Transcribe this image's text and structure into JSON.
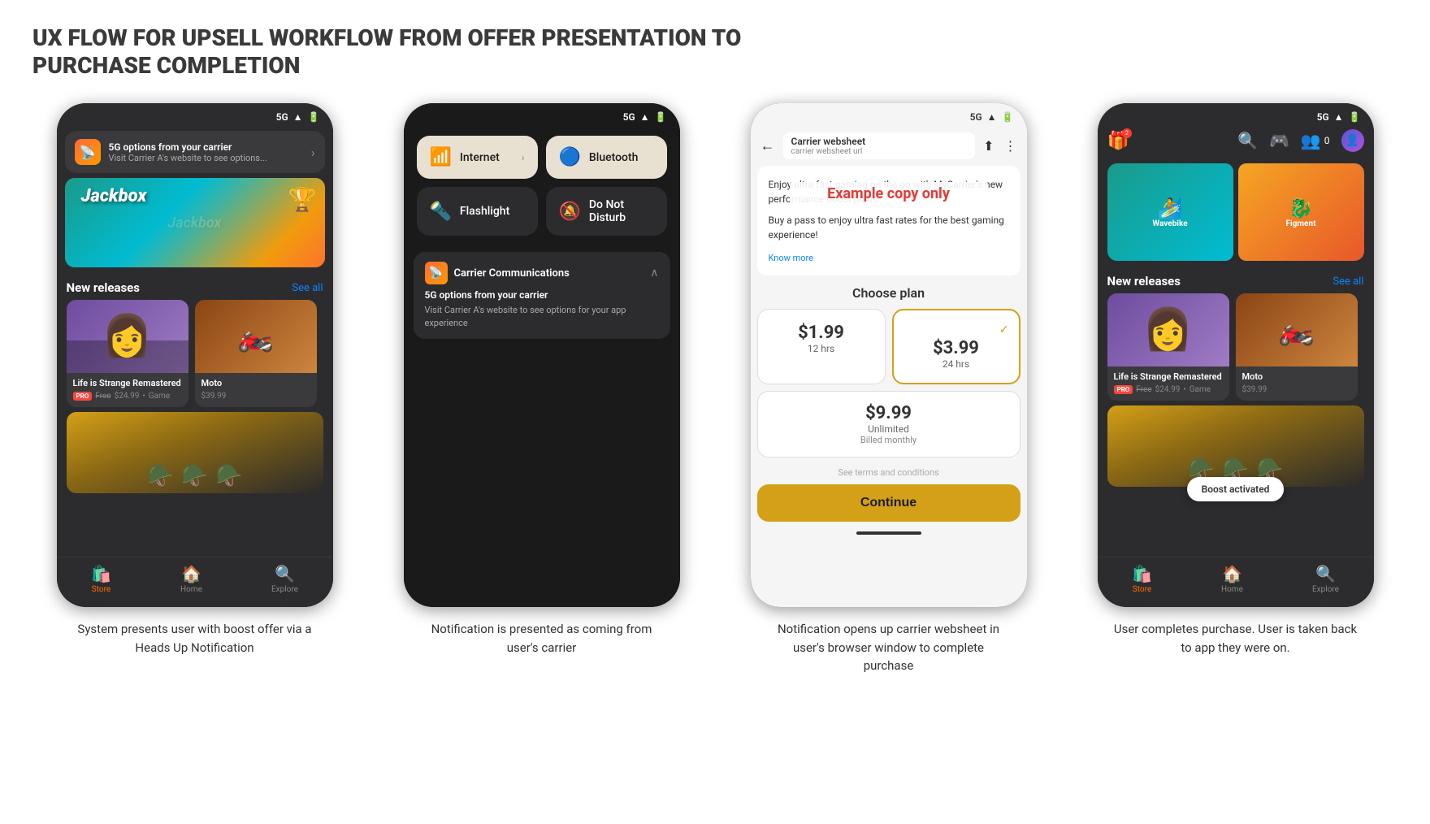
{
  "page": {
    "title": "UX FLOW FOR UPSELL WORKFLOW FROM OFFER PRESENTATION TO PURCHASE COMPLETION"
  },
  "phone1": {
    "status": "5G",
    "notification": {
      "title": "5G options from your carrier",
      "subtitle": "Visit Carrier A's website to see options..."
    },
    "game_banner": "Jackbox",
    "new_releases": "New releases",
    "see_all": "See all",
    "cards": [
      {
        "title": "Life is Strange Remastered",
        "pro": "PRO",
        "price_free": "Free",
        "price_orig": "$24.99",
        "genre": "Game"
      },
      {
        "title": "Moto",
        "price": "$39.99"
      }
    ],
    "nav": [
      "Store",
      "Home",
      "Explore"
    ],
    "caption": "System presents user with boost offer via a Heads Up Notification"
  },
  "phone2": {
    "status": "5G",
    "tiles": [
      {
        "icon": "wifi",
        "label": "Internet",
        "active": true,
        "arrow": true
      },
      {
        "icon": "bluetooth",
        "label": "Bluetooth",
        "active": true,
        "arrow": false
      },
      {
        "icon": "flashlight",
        "label": "Flashlight",
        "active": false,
        "arrow": false
      },
      {
        "icon": "dnd",
        "label": "Do Not Disturb",
        "active": false,
        "arrow": false
      }
    ],
    "carrier_notif": {
      "name": "Carrier Communications",
      "title": "5G options from your carrier",
      "body": "Visit Carrier A's website to see options for your app experience"
    },
    "caption": "Notification is presented as coming from user's carrier"
  },
  "phone3": {
    "status": "5G",
    "websheet": {
      "title": "Carrier websheet",
      "url": "carrier websheet url"
    },
    "promo_text": "Enjoy ultra fast gaming on the go with MyCarrier's new performance boost plans!",
    "promo_sub": "Buy a pass to enjoy ultra fast rates for the best gaming experience!",
    "example_copy": "Example copy only",
    "know_more": "Know more",
    "choose_plan": "Choose plan",
    "plans": [
      {
        "price": "$1.99",
        "duration": "12 hrs",
        "selected": false
      },
      {
        "price": "$3.99",
        "duration": "24 hrs",
        "selected": true
      }
    ],
    "plan_unlimited": {
      "price": "$9.99",
      "duration": "Unlimited",
      "note": "Billed monthly"
    },
    "terms": "See terms and conditions",
    "continue_btn": "Continue",
    "caption": "Notification opens up carrier websheet in user's browser window to complete purchase"
  },
  "phone4": {
    "status": "5G",
    "boost_activated": "Boost activated",
    "new_releases": "New releases",
    "see_all": "See all",
    "cards": [
      {
        "title": "Life is Strange Remastered",
        "pro": "PRO",
        "price_free": "Free",
        "price_orig": "$24.99",
        "genre": "Game"
      },
      {
        "title": "Moto",
        "price": "$39.99"
      }
    ],
    "nav": [
      "Store",
      "Home",
      "Explore"
    ],
    "caption": "User completes purchase. User is taken back to app they were on."
  }
}
